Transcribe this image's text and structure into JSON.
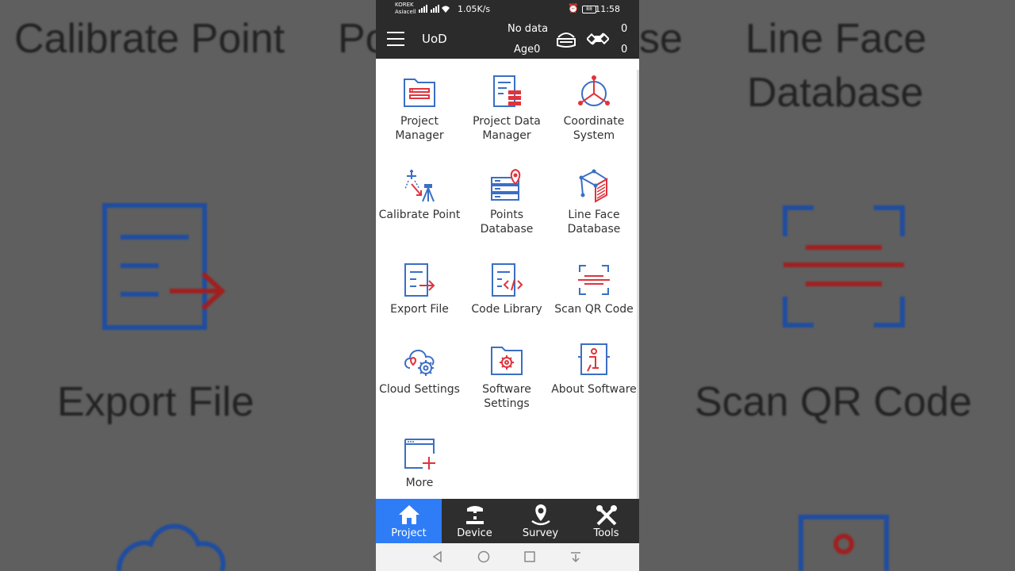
{
  "background": {
    "left_texts": [
      "Calibrate Point",
      "Export File"
    ],
    "right_texts": [
      "Line Face",
      "Database",
      "Scan QR Code"
    ],
    "left_partial": "Po",
    "right_partial": "se"
  },
  "status_bar": {
    "carrier_line1": "KOREK",
    "carrier_line2": "Asiacell",
    "speed": "1.05K/s",
    "battery": "88",
    "time": "11:58"
  },
  "app_bar": {
    "title": "UoD",
    "diff_status": "No data",
    "age": "Age0",
    "count_top": "0",
    "count_bottom": "0"
  },
  "tiles": [
    {
      "label_line1": "Project",
      "label_line2": "Manager",
      "icon": "project-manager-icon"
    },
    {
      "label_line1": "Project Data",
      "label_line2": "Manager",
      "icon": "project-data-manager-icon"
    },
    {
      "label_line1": "Coordinate",
      "label_line2": "System",
      "icon": "coordinate-system-icon"
    },
    {
      "label_line1": "Calibrate Point",
      "label_line2": "",
      "icon": "calibrate-point-icon"
    },
    {
      "label_line1": "Points Database",
      "label_line2": "",
      "icon": "points-database-icon"
    },
    {
      "label_line1": "Line Face",
      "label_line2": "Database",
      "icon": "line-face-database-icon"
    },
    {
      "label_line1": "Export File",
      "label_line2": "",
      "icon": "export-file-icon"
    },
    {
      "label_line1": "Code Library",
      "label_line2": "",
      "icon": "code-library-icon"
    },
    {
      "label_line1": "Scan QR Code",
      "label_line2": "",
      "icon": "scan-qr-code-icon"
    },
    {
      "label_line1": "Cloud Settings",
      "label_line2": "",
      "icon": "cloud-settings-icon"
    },
    {
      "label_line1": "Software",
      "label_line2": "Settings",
      "icon": "software-settings-icon"
    },
    {
      "label_line1": "About Software",
      "label_line2": "",
      "icon": "about-software-icon"
    },
    {
      "label_line1": "More",
      "label_line2": "",
      "icon": "more-icon"
    }
  ],
  "bottom_nav": [
    {
      "label": "Project",
      "active": true
    },
    {
      "label": "Device",
      "active": false
    },
    {
      "label": "Survey",
      "active": false
    },
    {
      "label": "Tools",
      "active": false
    }
  ],
  "colors": {
    "blue": "#3a6fc4",
    "red": "#e0333c",
    "accent": "#2f7df6",
    "bar": "#2b2b2b"
  }
}
